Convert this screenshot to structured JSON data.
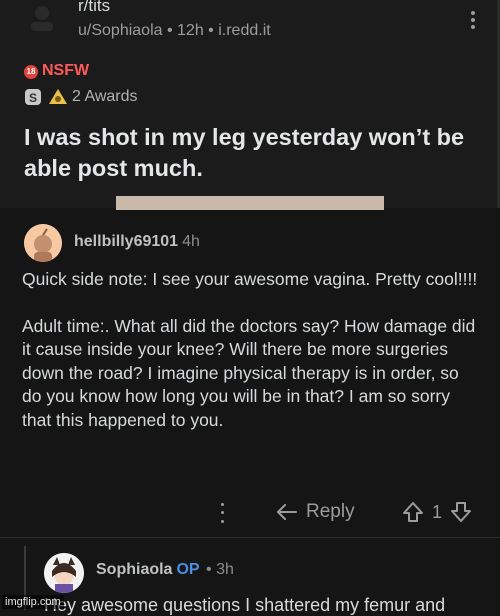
{
  "post": {
    "subreddit": "r/tits",
    "author": "u/Sophiaola",
    "age": "12h",
    "domain": "i.redd.it",
    "meta_sep": " • ",
    "nsfw_badge": "18",
    "nsfw_label": "NSFW",
    "awards_label": "2 Awards",
    "title": "I was shot in my leg yesterday won’t be able post much."
  },
  "comment": {
    "username": "hellbilly69101",
    "age": "4h",
    "paragraphs": [
      "Quick side note: I see your awesome vagina.  Pretty cool!!!!",
      "Adult time:. What all did the doctors say?  How damage did it cause inside your knee?  Will there be more surgeries down the road?  I imagine physical therapy is in order, so do you know how long you will be in that?  I am so sorry that this happened to you."
    ],
    "reply_label": "Reply",
    "score": "1"
  },
  "reply": {
    "username": "Sophiaola",
    "op_label": "OP",
    "age": "• 3h",
    "body_preview": "Hey awesome questions I shattered my femur and"
  },
  "watermark": "imgflip.com",
  "colors": {
    "nsfw": "#ff5a5a",
    "op_blue": "#4a90e2",
    "background": "#151515"
  },
  "icons": [
    "reddit-avatar-icon",
    "overflow-menu-icon",
    "silver-award-icon",
    "helpful-award-icon",
    "reply-arrow-icon",
    "upvote-icon",
    "downvote-icon"
  ]
}
